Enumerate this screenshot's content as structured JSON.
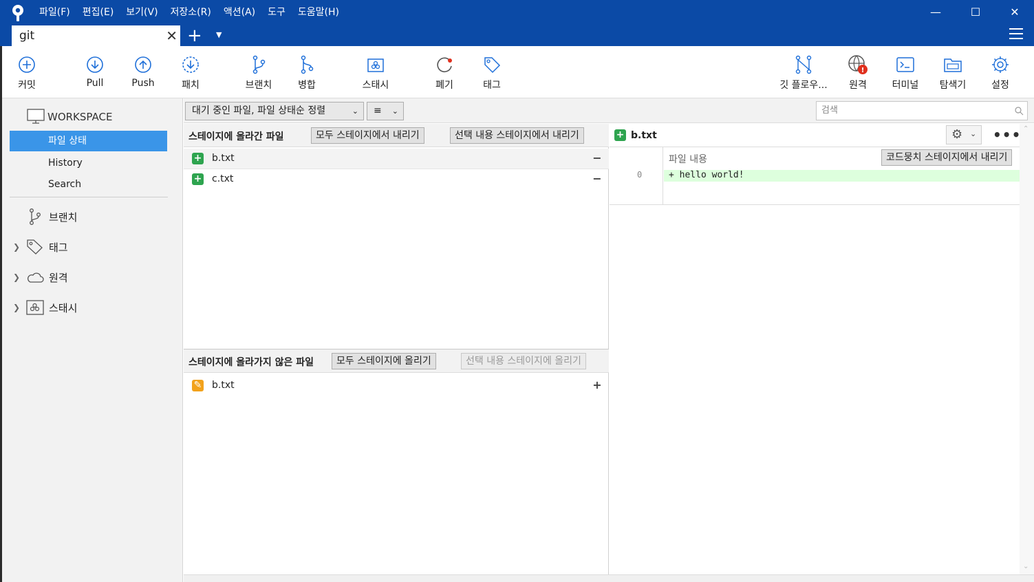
{
  "menu": [
    "파일(F)",
    "편집(E)",
    "보기(V)",
    "저장소(R)",
    "액션(A)",
    "도구",
    "도움말(H)"
  ],
  "tab": {
    "label": "git"
  },
  "toolbar": {
    "commit": "커밋",
    "pull": "Pull",
    "push": "Push",
    "fetch": "패치",
    "branch": "브랜치",
    "merge": "병합",
    "stash": "스태시",
    "discard": "폐기",
    "tag": "태그",
    "gitflow": "깃 플로우...",
    "remote": "원격",
    "terminal": "터미널",
    "explorer": "탐색기",
    "settings": "설정"
  },
  "sidebar": {
    "workspace": "WORKSPACE",
    "file_status": "파일 상태",
    "history": "History",
    "search": "Search",
    "branches": "브랜치",
    "tags": "태그",
    "remotes": "원격",
    "stashes": "스태시"
  },
  "filter": {
    "sort_label": "대기 중인 파일, 파일 상태순 정렬",
    "view_icon": "≡",
    "search_placeholder": "검색"
  },
  "staged": {
    "title": "스테이지에 올라간 파일",
    "unstage_all": "모두 스테이지에서 내리기",
    "unstage_selected": "선택 내용 스테이지에서 내리기",
    "files": [
      {
        "name": "b.txt",
        "status": "added"
      },
      {
        "name": "c.txt",
        "status": "added"
      }
    ]
  },
  "unstaged": {
    "title": "스테이지에 올라가지 않은 파일",
    "stage_all": "모두 스테이지에 올리기",
    "stage_selected": "선택 내용 스테이지에 올리기",
    "files": [
      {
        "name": "b.txt",
        "status": "modified"
      }
    ]
  },
  "diff": {
    "file": "b.txt",
    "hunk_header": "파일 내용",
    "unstage_hunk": "코드뭉치 스테이지에서 내리기",
    "lines": [
      {
        "num": "0",
        "text": "+ hello world!"
      }
    ]
  },
  "colors": {
    "titlebar": "#0b4aa6",
    "accent": "#3a95e8",
    "added": "#2ea44f",
    "modified": "#f2a21c",
    "alert": "#e0301e",
    "diff_added_bg": "#ddffdd"
  }
}
